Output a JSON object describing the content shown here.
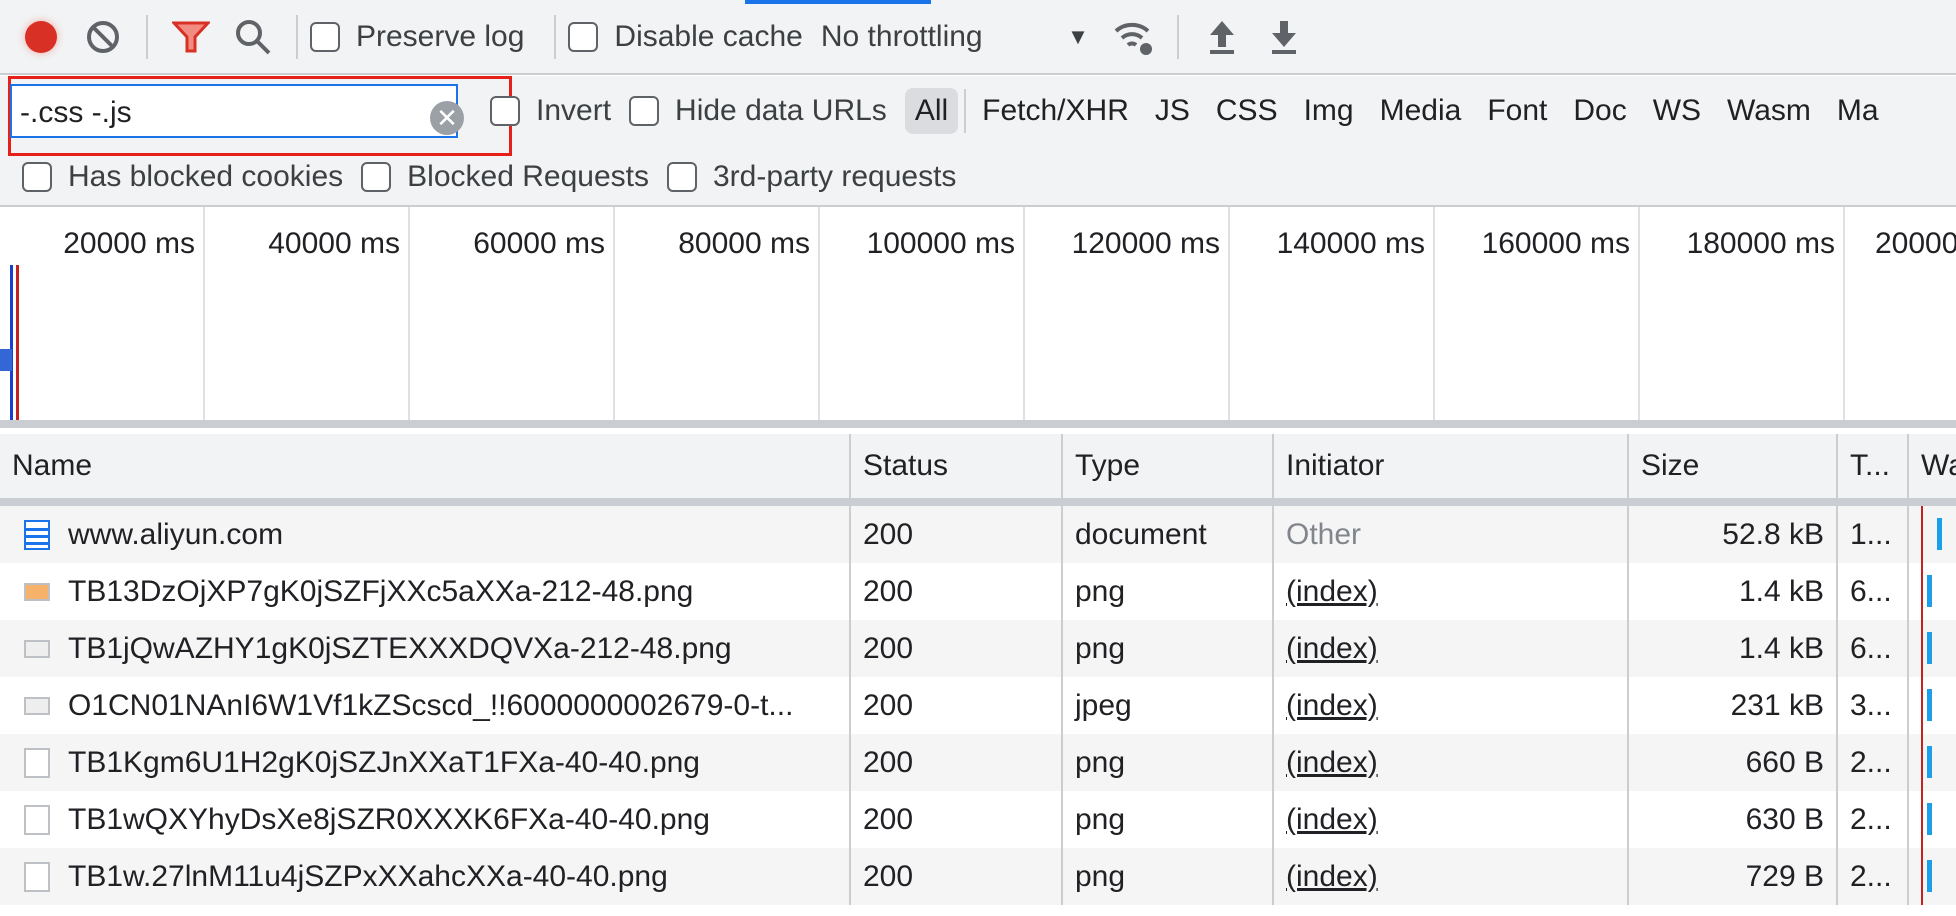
{
  "toolbar": {
    "preserve_log": "Preserve log",
    "disable_cache": "Disable cache",
    "throttling": "No throttling",
    "icons": [
      "record-icon",
      "clear-icon",
      "filter-icon",
      "search-icon",
      "network-conditions-icon",
      "upload-icon",
      "download-icon"
    ],
    "record_color": "#d93025",
    "filter_color": "#d93025"
  },
  "filter": {
    "value": "-.css -.js",
    "invert": "Invert",
    "hide_data_urls": "Hide data URLs",
    "types": [
      "All",
      "Fetch/XHR",
      "JS",
      "CSS",
      "Img",
      "Media",
      "Font",
      "Doc",
      "WS",
      "Wasm",
      "Ma"
    ],
    "selected": "All",
    "has_blocked_cookies": "Has blocked cookies",
    "blocked_requests": "Blocked Requests",
    "third_party": "3rd-party requests"
  },
  "timeline": {
    "ticks": [
      "20000 ms",
      "40000 ms",
      "60000 ms",
      "80000 ms",
      "100000 ms",
      "120000 ms",
      "140000 ms",
      "160000 ms",
      "180000 ms",
      "20000"
    ]
  },
  "table": {
    "headers": [
      "Name",
      "Status",
      "Type",
      "Initiator",
      "Size",
      "T...",
      "Wa"
    ],
    "rows": [
      {
        "name": "www.aliyun.com",
        "status": "200",
        "type": "document",
        "initiator": "Other",
        "size": "52.8 kB",
        "time": "1...",
        "icon": "document-icon"
      },
      {
        "name": "TB13DzOjXP7gK0jSZFjXXc5aXXa-212-48.png",
        "status": "200",
        "type": "png",
        "initiator": "(index)",
        "size": "1.4 kB",
        "time": "6...",
        "icon": "image-icon"
      },
      {
        "name": "TB1jQwAZHY1gK0jSZTEXXXDQVXa-212-48.png",
        "status": "200",
        "type": "png",
        "initiator": "(index)",
        "size": "1.4 kB",
        "time": "6...",
        "icon": "image-icon"
      },
      {
        "name": "O1CN01NAnI6W1Vf1kZScscd_!!6000000002679-0-t...",
        "status": "200",
        "type": "jpeg",
        "initiator": "(index)",
        "size": "231 kB",
        "time": "3...",
        "icon": "image-icon"
      },
      {
        "name": "TB1Kgm6U1H2gK0jSZJnXXaT1FXa-40-40.png",
        "status": "200",
        "type": "png",
        "initiator": "(index)",
        "size": "660 B",
        "time": "2...",
        "icon": "image-icon"
      },
      {
        "name": "TB1wQXYhyDsXe8jSZR0XXXK6FXa-40-40.png",
        "status": "200",
        "type": "png",
        "initiator": "(index)",
        "size": "630 B",
        "time": "2...",
        "icon": "image-icon"
      },
      {
        "name": "TB1w.27lnM11u4jSZPxXXahcXXa-40-40.png",
        "status": "200",
        "type": "png",
        "initiator": "(index)",
        "size": "729 B",
        "time": "2...",
        "icon": "image-icon"
      }
    ]
  }
}
